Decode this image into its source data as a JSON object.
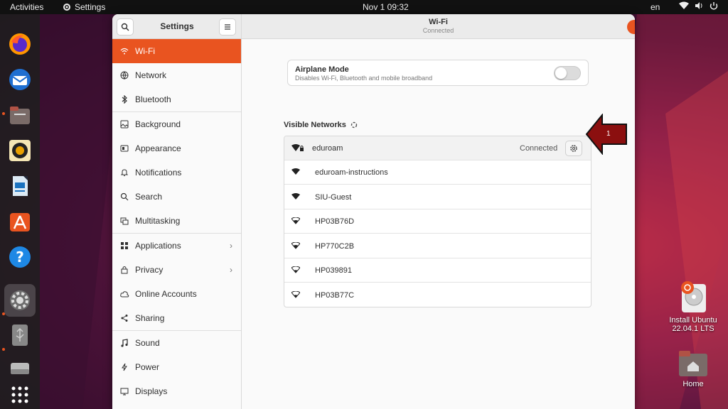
{
  "topbar": {
    "activities": "Activities",
    "app_name": "Settings",
    "clock": "Nov 1  09:32",
    "lang": "en"
  },
  "dock": {
    "items": [
      "firefox-icon",
      "thunderbird-icon",
      "files-icon",
      "rhythmbox-icon",
      "writer-icon",
      "software-icon",
      "help-icon",
      "settings-icon",
      "usb-drive-icon",
      "drive-icon",
      "app-grid-icon"
    ]
  },
  "settings_window": {
    "sidebar_title": "Settings",
    "panel_title": "Wi-Fi",
    "panel_subtitle": "Connected",
    "wifi_enabled": true
  },
  "sidebar": {
    "items": [
      {
        "label": "Wi-Fi",
        "icon": "wifi-icon",
        "active": true
      },
      {
        "label": "Network",
        "icon": "network-icon"
      },
      {
        "label": "Bluetooth",
        "icon": "bluetooth-icon"
      },
      {
        "label": "Background",
        "icon": "background-icon"
      },
      {
        "label": "Appearance",
        "icon": "appearance-icon"
      },
      {
        "label": "Notifications",
        "icon": "bell-icon"
      },
      {
        "label": "Search",
        "icon": "search-icon"
      },
      {
        "label": "Multitasking",
        "icon": "multitasking-icon"
      },
      {
        "label": "Applications",
        "icon": "grid-icon",
        "chevron": true
      },
      {
        "label": "Privacy",
        "icon": "lock-icon",
        "chevron": true
      },
      {
        "label": "Online Accounts",
        "icon": "cloud-icon"
      },
      {
        "label": "Sharing",
        "icon": "share-icon"
      },
      {
        "label": "Sound",
        "icon": "music-note-icon"
      },
      {
        "label": "Power",
        "icon": "power-icon"
      },
      {
        "label": "Displays",
        "icon": "display-icon"
      }
    ]
  },
  "airplane": {
    "title": "Airplane Mode",
    "description": "Disables Wi-Fi, Bluetooth and mobile broadband",
    "enabled": false
  },
  "networks": {
    "label": "Visible Networks",
    "rows": [
      {
        "ssid": "eduroam",
        "status": "Connected",
        "secured": true
      },
      {
        "ssid": "eduroam-instructions"
      },
      {
        "ssid": "SIU-Guest"
      },
      {
        "ssid": "HP03B76D"
      },
      {
        "ssid": "HP770C2B"
      },
      {
        "ssid": "HP039891"
      },
      {
        "ssid": "HP03B77C"
      }
    ]
  },
  "callout": {
    "number": "1",
    "color": "#8b0f0f"
  },
  "desktop": {
    "install_label_1": "Install Ubuntu",
    "install_label_2": "22.04.1 LTS",
    "home_label": "Home"
  },
  "colors": {
    "accent": "#e95420"
  }
}
